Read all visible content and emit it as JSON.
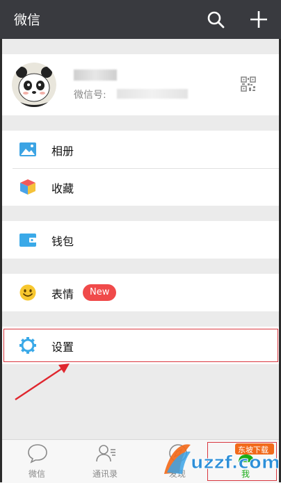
{
  "header": {
    "title": "微信",
    "search_icon": "search-icon",
    "add_icon": "plus-icon",
    "background": "#393a3f"
  },
  "profile": {
    "wechat_id_label": "微信号:",
    "qr_icon": "qr-code-icon"
  },
  "menu": {
    "album": {
      "label": "相册",
      "icon": "photo-album-icon",
      "color": "#3ca4e4"
    },
    "favorites": {
      "label": "收藏",
      "icon": "favorites-cube-icon"
    },
    "wallet": {
      "label": "钱包",
      "icon": "wallet-icon",
      "color": "#3aa9e8"
    },
    "stickers": {
      "label": "表情",
      "icon": "smiley-icon",
      "badge": "New",
      "badge_color": "#f04a4a"
    },
    "settings": {
      "label": "设置",
      "icon": "gear-icon",
      "color": "#3aa9e8"
    }
  },
  "tabbar": {
    "tabs": [
      {
        "label": "微信",
        "icon": "chat-bubble-icon"
      },
      {
        "label": "通讯录",
        "icon": "contacts-icon"
      },
      {
        "label": "发现",
        "icon": "compass-icon"
      },
      {
        "label": "我",
        "icon": "person-icon",
        "active": true
      }
    ],
    "active_color": "#1aad19"
  },
  "watermark": {
    "text_main": "uzzf.com",
    "text_small": "东坡下载"
  }
}
